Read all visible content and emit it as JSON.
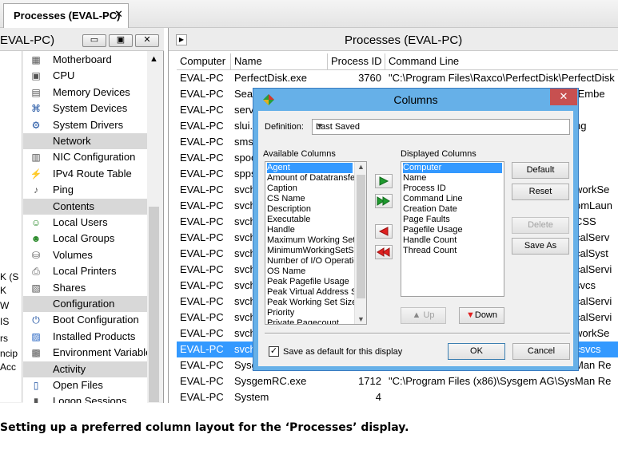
{
  "tab": {
    "label": "Processes (EVAL-PC)",
    "close": "✕"
  },
  "left_pane": {
    "title": "EVAL-PC)",
    "buttons": [
      "▭",
      "▣",
      "✕"
    ],
    "cutoff_text": [
      "K (S",
      "K",
      "W",
      "IS",
      "rs",
      "ncip",
      "Acc"
    ],
    "items": [
      {
        "type": "item",
        "label": "Motherboard",
        "icon": "motherboard-icon"
      },
      {
        "type": "item",
        "label": "CPU",
        "icon": "cpu-icon"
      },
      {
        "type": "item",
        "label": "Memory Devices",
        "icon": "memory-icon"
      },
      {
        "type": "item",
        "label": "System Devices",
        "icon": "devices-icon"
      },
      {
        "type": "item",
        "label": "System Drivers",
        "icon": "drivers-icon"
      },
      {
        "type": "section",
        "label": "Network"
      },
      {
        "type": "item",
        "label": "NIC Configuration",
        "icon": "nic-icon"
      },
      {
        "type": "item",
        "label": "IPv4 Route Table",
        "icon": "route-icon"
      },
      {
        "type": "item",
        "label": "Ping",
        "icon": "ping-icon"
      },
      {
        "type": "section",
        "label": "Contents"
      },
      {
        "type": "item",
        "label": "Local Users",
        "icon": "user-icon"
      },
      {
        "type": "item",
        "label": "Local Groups",
        "icon": "group-icon"
      },
      {
        "type": "item",
        "label": "Volumes",
        "icon": "volume-icon"
      },
      {
        "type": "item",
        "label": "Local Printers",
        "icon": "printer-icon"
      },
      {
        "type": "item",
        "label": "Shares",
        "icon": "share-icon"
      },
      {
        "type": "section",
        "label": "Configuration"
      },
      {
        "type": "item",
        "label": "Boot Configuration",
        "icon": "power-icon"
      },
      {
        "type": "item",
        "label": "Installed Products",
        "icon": "products-icon"
      },
      {
        "type": "item",
        "label": "Environment Variables",
        "icon": "env-icon"
      },
      {
        "type": "section",
        "label": "Activity"
      },
      {
        "type": "item",
        "label": "Open Files",
        "icon": "files-icon"
      },
      {
        "type": "item",
        "label": "Logon Sessions",
        "icon": "session-icon"
      }
    ]
  },
  "main": {
    "title": "Processes (EVAL-PC)",
    "columns": [
      "Computer",
      "Name",
      "Process ID",
      "Command Line"
    ],
    "rows": [
      {
        "computer": "EVAL-PC",
        "name": "PerfectDisk.exe",
        "pid": "3760",
        "cmd": "\"C:\\Program Files\\Raxco\\PerfectDisk\\PerfectDisk",
        "right": ""
      },
      {
        "computer": "EVAL-PC",
        "name": "Sea",
        "pid": "",
        "cmd": "",
        "right": "/Embe"
      },
      {
        "computer": "EVAL-PC",
        "name": "serv",
        "pid": "",
        "cmd": "",
        "right": ""
      },
      {
        "computer": "EVAL-PC",
        "name": "slui.",
        "pid": "",
        "cmd": "",
        "right": "ng"
      },
      {
        "computer": "EVAL-PC",
        "name": "sms",
        "pid": "",
        "cmd": "",
        "right": ""
      },
      {
        "computer": "EVAL-PC",
        "name": "spoo",
        "pid": "",
        "cmd": "",
        "right": ""
      },
      {
        "computer": "EVAL-PC",
        "name": "spps",
        "pid": "",
        "cmd": "",
        "right": ""
      },
      {
        "computer": "EVAL-PC",
        "name": "svch",
        "pid": "",
        "cmd": "",
        "right": "workSe"
      },
      {
        "computer": "EVAL-PC",
        "name": "svch",
        "pid": "",
        "cmd": "",
        "right": "omLaun"
      },
      {
        "computer": "EVAL-PC",
        "name": "svch",
        "pid": "",
        "cmd": "",
        "right": "CSS"
      },
      {
        "computer": "EVAL-PC",
        "name": "svch",
        "pid": "",
        "cmd": "",
        "right": "calServ"
      },
      {
        "computer": "EVAL-PC",
        "name": "svch",
        "pid": "",
        "cmd": "",
        "right": "calSyst"
      },
      {
        "computer": "EVAL-PC",
        "name": "svch",
        "pid": "",
        "cmd": "",
        "right": "calServi"
      },
      {
        "computer": "EVAL-PC",
        "name": "svch",
        "pid": "",
        "cmd": "",
        "right": "svcs"
      },
      {
        "computer": "EVAL-PC",
        "name": "svch",
        "pid": "",
        "cmd": "",
        "right": "calServi"
      },
      {
        "computer": "EVAL-PC",
        "name": "svch",
        "pid": "",
        "cmd": "",
        "right": "calServi"
      },
      {
        "computer": "EVAL-PC",
        "name": "svch",
        "pid": "",
        "cmd": "",
        "right": "workSe"
      },
      {
        "computer": "EVAL-PC",
        "name": "svch",
        "pid": "",
        "cmd": "",
        "right": "csvcs",
        "selected": true
      },
      {
        "computer": "EVAL-PC",
        "name": "Sysg",
        "pid": "",
        "cmd": "",
        "right": "Man Re"
      },
      {
        "computer": "EVAL-PC",
        "name": "SysgemRC.exe",
        "pid": "1712",
        "cmd": "\"C:\\Program Files (x86)\\Sysgem AG\\SysMan Re",
        "right": ""
      },
      {
        "computer": "EVAL-PC",
        "name": "System",
        "pid": "4",
        "cmd": "",
        "right": ""
      }
    ]
  },
  "dialog": {
    "title": "Columns",
    "close": "✕",
    "definition_label": "Definition:",
    "definition_value": "Last Saved",
    "available_label": "Available Columns",
    "displayed_label": "Displayed Columns",
    "available": [
      "Agent",
      "Amount of Datatransfer",
      "Caption",
      "CS Name",
      "Description",
      "Executable",
      "Handle",
      "Maximum Working Set",
      "MinimumWorkingSetSize",
      "Number of I/O Operations",
      "OS Name",
      "Peak Pagefile Usage",
      "Peak Virtual Address Space",
      "Peak Working Set Size",
      "Priority",
      "Private Pagecount"
    ],
    "displayed": [
      "Computer",
      "Name",
      "Process ID",
      "Command Line",
      "Creation Date",
      "Page Faults",
      "Pagefile Usage",
      "Handle Count",
      "Thread Count"
    ],
    "buttons": {
      "default": "Default",
      "reset": "Reset",
      "delete": "Delete",
      "save_as": "Save As",
      "up": "Up",
      "down": "Down",
      "ok": "OK",
      "cancel": "Cancel"
    },
    "checkbox_label": "Save as default for this display",
    "checkbox_checked": true
  },
  "caption": "Setting up a preferred column layout for the ‘Processes’ display."
}
